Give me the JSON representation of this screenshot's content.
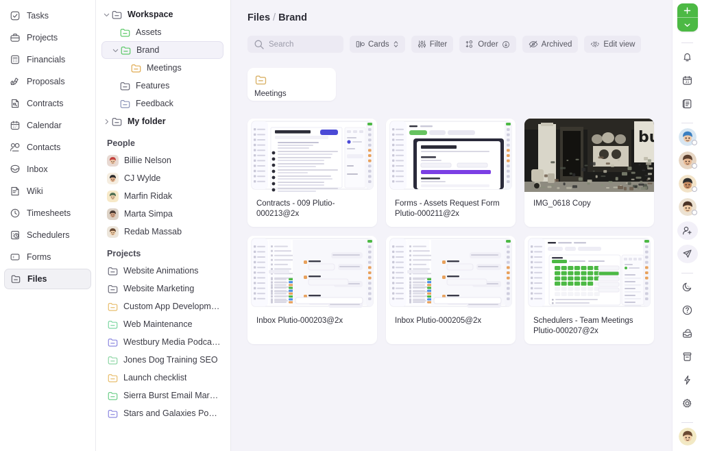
{
  "left_nav": {
    "items": [
      {
        "label": "Tasks",
        "icon": "check-square-icon"
      },
      {
        "label": "Projects",
        "icon": "briefcase-icon"
      },
      {
        "label": "Financials",
        "icon": "calculator-icon"
      },
      {
        "label": "Proposals",
        "icon": "pen-icon"
      },
      {
        "label": "Contracts",
        "icon": "contract-icon"
      },
      {
        "label": "Calendar",
        "icon": "calendar-icon"
      },
      {
        "label": "Contacts",
        "icon": "people-icon"
      },
      {
        "label": "Inbox",
        "icon": "inbox-icon"
      },
      {
        "label": "Wiki",
        "icon": "book-icon"
      },
      {
        "label": "Timesheets",
        "icon": "clock-icon"
      },
      {
        "label": "Schedulers",
        "icon": "scheduler-icon"
      },
      {
        "label": "Forms",
        "icon": "form-icon"
      },
      {
        "label": "Files",
        "icon": "folder-icon",
        "active": true
      }
    ]
  },
  "tree": {
    "workspace": {
      "label": "Workspace",
      "items": [
        {
          "label": "Assets",
          "color": "#5fc96a",
          "indent": 1
        },
        {
          "label": "Brand",
          "color": "#5fc96a",
          "indent": 1,
          "selected": true,
          "expanded": true
        },
        {
          "label": "Meetings",
          "color": "#e0ab52",
          "indent": 2
        },
        {
          "label": "Features",
          "color": "#6f6f7d",
          "indent": 1
        },
        {
          "label": "Feedback",
          "color": "#8b93b8",
          "indent": 1
        }
      ]
    },
    "my_folder": {
      "label": "My folder"
    },
    "people_heading": "People",
    "people": [
      {
        "name": "Billie Nelson",
        "bg": "#e8d9d2",
        "hair": "#c2413d",
        "skin": "#f0c9a8"
      },
      {
        "name": "CJ Wylde",
        "bg": "#f5ede0",
        "hair": "#2c2c2c",
        "skin": "#e8b892"
      },
      {
        "name": "Marfin Ridak",
        "bg": "#f7e9c8",
        "hair": "#4f6e52",
        "skin": "#f2d3ad"
      },
      {
        "name": "Marta Simpa",
        "bg": "#ddd2c6",
        "hair": "#4a3a32",
        "skin": "#d8a98a"
      },
      {
        "name": "Redab Massab",
        "bg": "#ece5da",
        "hair": "#6a4a33",
        "skin": "#f1cda6"
      }
    ],
    "projects_heading": "Projects",
    "projects": [
      {
        "label": "Website Animations",
        "color": "#6f6f7d"
      },
      {
        "label": "Website Marketing",
        "color": "#6f6f7d"
      },
      {
        "label": "Custom App Development",
        "color": "#e8be6e"
      },
      {
        "label": "Web Maintenance",
        "color": "#7ed7a3"
      },
      {
        "label": "Westbury Media Podcast...",
        "color": "#8e8ae0"
      },
      {
        "label": "Jones Dog Training SEO",
        "color": "#8fd6a6"
      },
      {
        "label": "Launch checklist",
        "color": "#e8be6e"
      },
      {
        "label": "Sierra Burst Email Marke...",
        "color": "#6fcf8a"
      },
      {
        "label": "Stars and Galaxies Podc...",
        "color": "#8e8ae0"
      }
    ]
  },
  "main": {
    "breadcrumb": {
      "root": "Files",
      "separator": "/",
      "current": "Brand"
    },
    "toolbar": {
      "search_placeholder": "Search",
      "cards_label": "Cards",
      "filter_label": "Filter",
      "order_label": "Order",
      "archived_label": "Archived",
      "edit_view_label": "Edit view"
    },
    "folders": [
      {
        "name": "Meetings",
        "color": "#d9b166"
      }
    ],
    "files": [
      {
        "name": "Contracts - 009 Plutio-000213@2x",
        "thumb": "contract-doc"
      },
      {
        "name": "Forms - Assets Request Form Plutio-000211@2x",
        "thumb": "assets-form"
      },
      {
        "name": "IMG_0618 Copy",
        "thumb": "street-photo"
      },
      {
        "name": "Inbox Plutio-000203@2x",
        "thumb": "inbox-chat"
      },
      {
        "name": "Inbox Plutio-000205@2x",
        "thumb": "inbox-chat"
      },
      {
        "name": "Schedulers - Team Meetings Plutio-000207@2x",
        "thumb": "scheduler-calendar"
      }
    ]
  },
  "rail": {
    "add_button": {
      "icon": "plus-icon",
      "chevron": "chevron-down-icon",
      "color": "#4cb944"
    },
    "items": [
      {
        "icon": "bell-icon",
        "name": "notifications"
      },
      {
        "icon": "calendar-31-icon",
        "name": "calendar"
      },
      {
        "icon": "notes-icon",
        "name": "notes"
      }
    ],
    "avatars": [
      {
        "name": "team-member-1",
        "bg": "#d7e6f2",
        "hair": "#3a7fc1",
        "skin": "#f0c9a8"
      },
      {
        "name": "team-member-2",
        "bg": "#e6d5c3",
        "hair": "#5b3f2e",
        "skin": "#e8b892"
      },
      {
        "name": "team-member-3",
        "bg": "#f2e3c8",
        "hair": "#2e2e2e",
        "skin": "#c98e63"
      },
      {
        "name": "team-member-4",
        "bg": "#ece2d2",
        "hair": "#4a3326",
        "skin": "#f1cda6"
      }
    ],
    "actions": [
      {
        "icon": "add-person-icon",
        "name": "invite-people",
        "tinted": true
      },
      {
        "icon": "send-icon",
        "name": "send",
        "tinted": true
      }
    ],
    "utility": [
      {
        "icon": "moon-icon",
        "name": "dark-mode"
      },
      {
        "icon": "help-icon",
        "name": "help"
      },
      {
        "icon": "inbox-tray-icon",
        "name": "archive-tray"
      },
      {
        "icon": "archive-box-icon",
        "name": "archive"
      },
      {
        "icon": "bolt-icon",
        "name": "automations"
      },
      {
        "icon": "gear-icon",
        "name": "settings"
      }
    ],
    "profile": {
      "name": "current-user-avatar",
      "bg": "#f2e9c4",
      "hair": "#6a4a33",
      "skin": "#f1cda6"
    }
  }
}
